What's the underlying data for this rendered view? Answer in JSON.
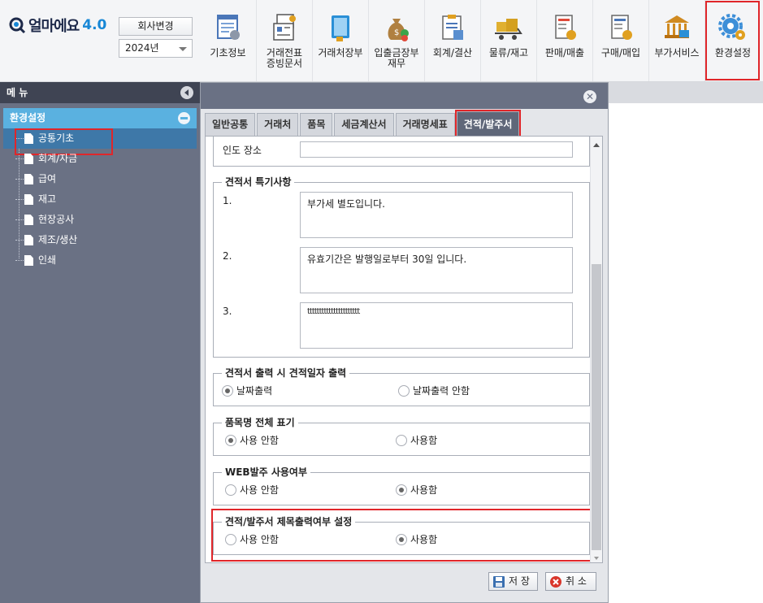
{
  "app": {
    "logo_text": "얼마에요",
    "logo_version": "4.0"
  },
  "header": {
    "company_button": "회사변경",
    "year_value": "2024년",
    "menu": [
      {
        "label": "기초정보",
        "icon": "basic-info-icon"
      },
      {
        "label": "거래전표\n증빙문서",
        "icon": "voucher-icon"
      },
      {
        "label": "거래처장부",
        "icon": "ledger-book-icon"
      },
      {
        "label": "입출금장부\n재무",
        "icon": "money-bag-icon"
      },
      {
        "label": "회계/결산",
        "icon": "accounting-icon"
      },
      {
        "label": "물류/재고",
        "icon": "logistics-cart-icon"
      },
      {
        "label": "판매/매출",
        "icon": "sales-icon"
      },
      {
        "label": "구매/매입",
        "icon": "purchase-icon"
      },
      {
        "label": "부가서비스",
        "icon": "bank-building-icon"
      },
      {
        "label": "환경설정",
        "icon": "settings-gear-icon"
      }
    ]
  },
  "sidebar": {
    "title": "메 뉴",
    "group": "환경설정",
    "items": [
      {
        "label": "공통기초"
      },
      {
        "label": "회계/자금"
      },
      {
        "label": "급여"
      },
      {
        "label": "재고"
      },
      {
        "label": "현장공사"
      },
      {
        "label": "제조/생산"
      },
      {
        "label": "인쇄"
      }
    ]
  },
  "dialog": {
    "tabs": [
      "일반공통",
      "거래처",
      "품목",
      "세금계산서",
      "거래명세표",
      "견적/발주서"
    ],
    "delivery_place_label": "인도 장소",
    "delivery_place_value": "",
    "notes_section": {
      "legend": "견적서 특기사항",
      "rows": [
        {
          "label": "1.",
          "value": "부가세 별도입니다."
        },
        {
          "label": "2.",
          "value": "유효기간은 발행일로부터 30일 입니다."
        },
        {
          "label": "3.",
          "value": "tttttttttttttttttttttt"
        }
      ]
    },
    "date_output": {
      "legend": "견적서 출력 시 견적일자 출력",
      "option_a": "날짜출력",
      "option_b": "날짜출력 안함",
      "selected": "option_a"
    },
    "item_name_full": {
      "legend": "품목명 전체 표기",
      "option_a": "사용 안함",
      "option_b": "사용함",
      "selected": "option_a"
    },
    "web_order": {
      "legend": "WEB발주 사용여부",
      "option_a": "사용 안함",
      "option_b": "사용함",
      "selected": "option_b"
    },
    "title_output": {
      "legend": "견적/발주서 제목출력여부 설정",
      "option_a": "사용 안함",
      "option_b": "사용함",
      "selected": "option_b"
    },
    "save_button": "저 장",
    "cancel_button": "취 소"
  },
  "colors": {
    "highlight": "#e0262a",
    "sidebar_bg": "#6a7184",
    "sidebar_group": "#5ab1e0",
    "active_tab": "#5f6779"
  }
}
